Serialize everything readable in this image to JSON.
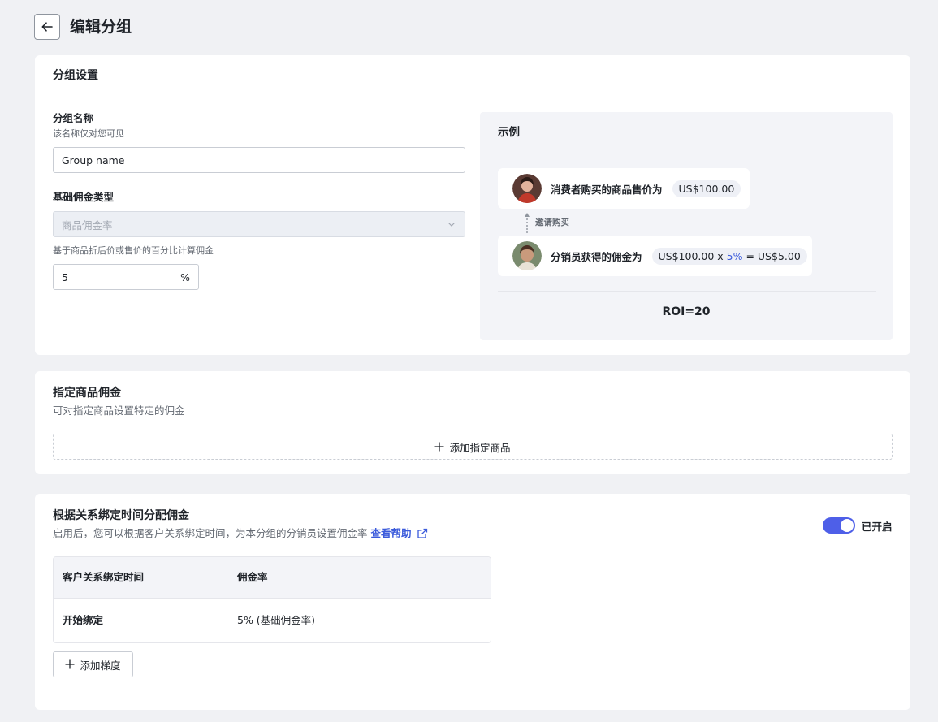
{
  "header": {
    "title": "编辑分组"
  },
  "group_settings": {
    "title": "分组设置",
    "name_label": "分组名称",
    "name_hint": "该名称仅对您可见",
    "name_value": "Group name",
    "commission_type_label": "基础佣金类型",
    "commission_type_value": "商品佣金率",
    "rate_hint": "基于商品折后价或售价的百分比计算佣金",
    "rate_value": "5",
    "rate_unit": "%"
  },
  "example": {
    "title": "示例",
    "consumer_text": "消费者购买的商品售价为",
    "consumer_price": "US$100.00",
    "invite_label": "邀请购买",
    "distributor_text": "分销员获得的佣金为",
    "formula_base": "US$100.00 x ",
    "formula_rate": "5%",
    "formula_result": " = US$5.00",
    "roi": "ROI=20"
  },
  "product_commission": {
    "title": "指定商品佣金",
    "subtitle": "可对指定商品设置特定的佣金",
    "add_label": "添加指定商品"
  },
  "time_commission": {
    "title": "根据关系绑定时间分配佣金",
    "subtitle": "启用后，您可以根据客户关系绑定时间，为本分组的分销员设置佣金率",
    "help_link": "查看帮助",
    "toggle_label": "已开启",
    "toggle_on": true,
    "columns": [
      "客户关系绑定时间",
      "佣金率"
    ],
    "rows": [
      [
        "开始绑定",
        "5% (基础佣金率)"
      ]
    ],
    "add_step_label": "添加梯度"
  },
  "colors": {
    "accent": "#4e5fe8",
    "link": "#3b5bdb",
    "page_bg": "#f0f1f4"
  }
}
